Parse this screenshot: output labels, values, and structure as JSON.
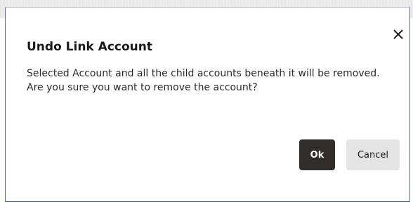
{
  "dialog": {
    "title": "Undo Link Account",
    "message_line1": "Selected Account and all the child accounts beneath it will be removed.",
    "message_line2": "Are you sure you want to remove the account?",
    "ok_label": "Ok",
    "cancel_label": "Cancel",
    "close_icon": "close-icon"
  },
  "colors": {
    "ok_button_bg": "#312d2a",
    "cancel_button_bg": "#e4e4e4",
    "dialog_border": "#4a6fa8"
  }
}
